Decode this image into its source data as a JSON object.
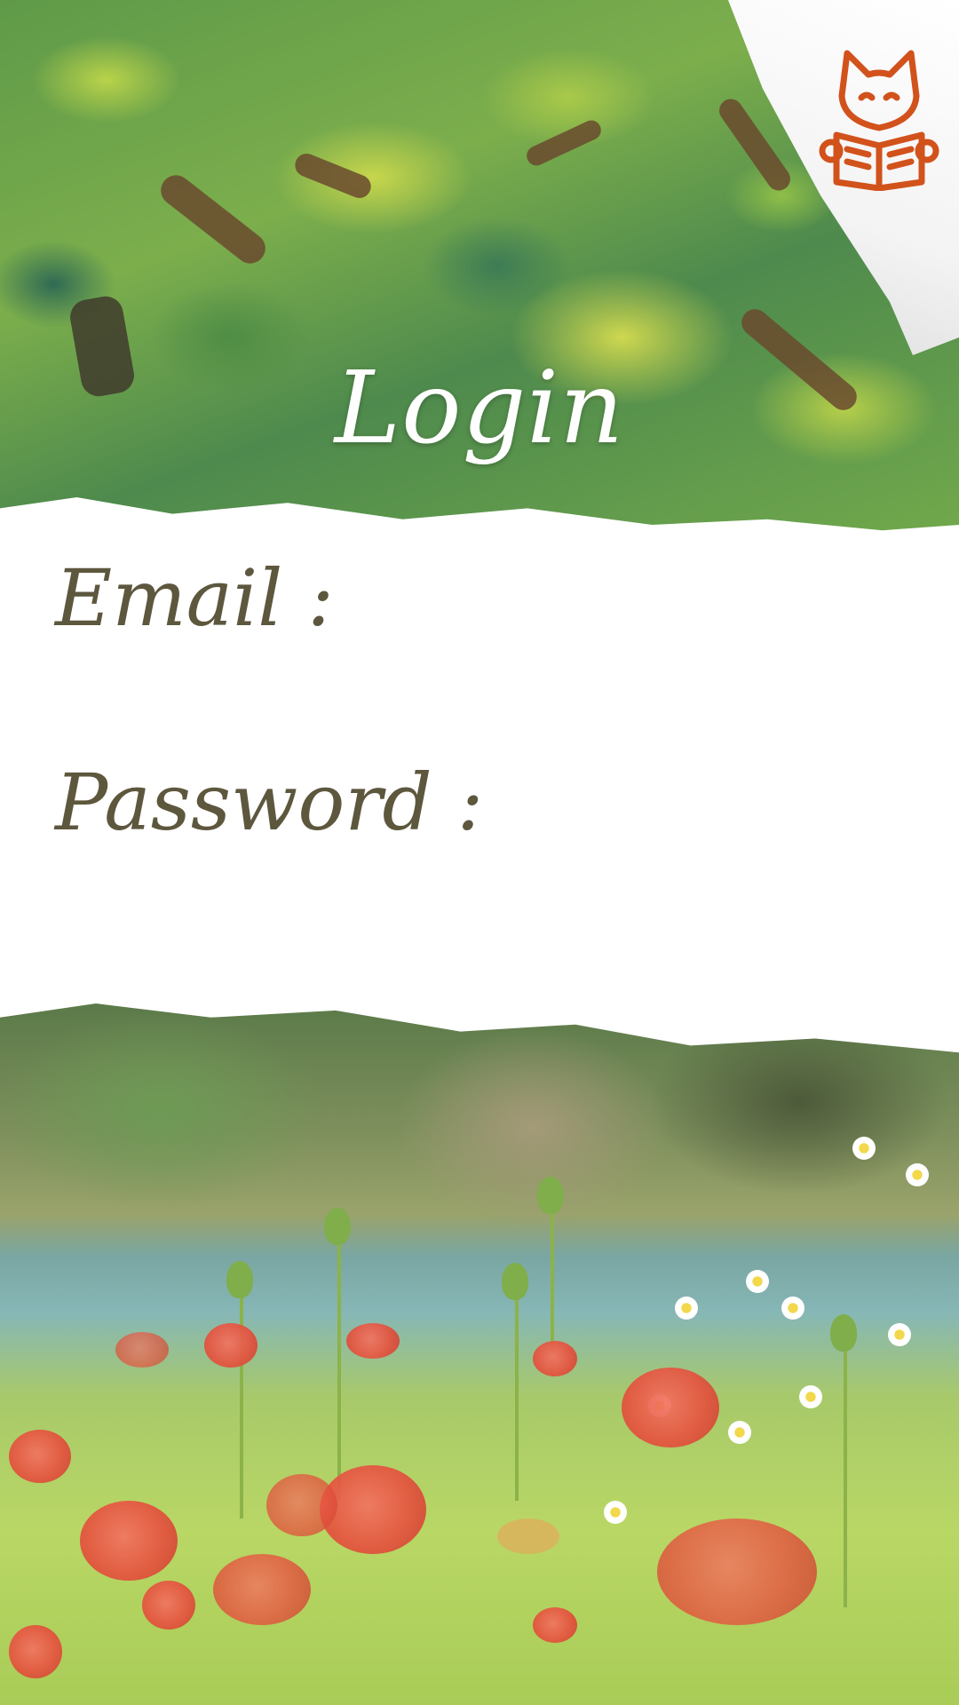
{
  "header": {
    "title": "Login",
    "logo_icon": "fox-reading-book-icon",
    "logo_color": "#D2521C"
  },
  "form": {
    "email_label": "Email :",
    "email_value": "",
    "password_label": "Password :",
    "password_value": ""
  },
  "colors": {
    "label_text": "#5D573E",
    "title_text": "#FFFFFF"
  }
}
